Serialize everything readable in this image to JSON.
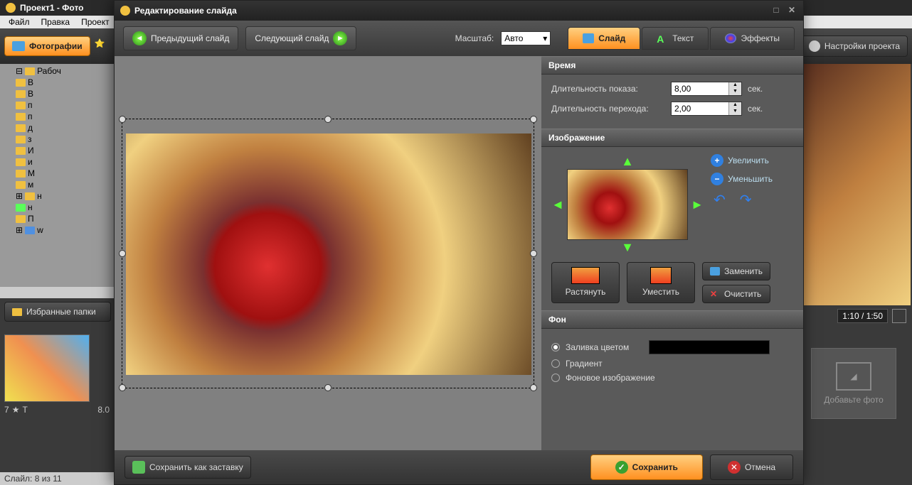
{
  "main": {
    "title": "Проект1 - Фото",
    "menu": {
      "file": "Файл",
      "edit": "Правка",
      "project": "Проект"
    },
    "toolbar": {
      "photos": "Фотографии",
      "settings": "Настройки проекта"
    },
    "tree": [
      "Рабоч",
      "В",
      "В",
      "п",
      "п",
      "д",
      "з",
      "И",
      "и",
      "М",
      "м",
      "н",
      "н",
      "П",
      "w"
    ],
    "favorites": "Избранные папки",
    "thumb_rating": "8.0",
    "thumb_index": "7",
    "timeline": "1:10 / 1:50",
    "add_photo": "Добавьте фото",
    "status": "Слайл: 8 из 11"
  },
  "dialog": {
    "title": "Редактирование слайда",
    "nav": {
      "prev": "Предыдущий слайд",
      "next": "Следующий слайд"
    },
    "scale_label": "Масштаб:",
    "scale_value": "Авто",
    "tabs": {
      "slide": "Слайд",
      "text": "Текст",
      "effects": "Эффекты"
    },
    "time": {
      "header": "Время",
      "show_label": "Длительность показа:",
      "show_value": "8,00",
      "trans_label": "Длительность перехода:",
      "trans_value": "2,00",
      "unit": "сек."
    },
    "image": {
      "header": "Изображение",
      "zoom_in": "Увеличить",
      "zoom_out": "Уменьшить",
      "stretch": "Растянуть",
      "fit": "Уместить",
      "replace": "Заменить",
      "clear": "Очистить"
    },
    "bg": {
      "header": "Фон",
      "fill": "Заливка цветом",
      "gradient": "Градиент",
      "image": "Фоновое изображение"
    },
    "footer": {
      "save_intro": "Сохранить как заставку",
      "save": "Сохранить",
      "cancel": "Отмена"
    }
  }
}
